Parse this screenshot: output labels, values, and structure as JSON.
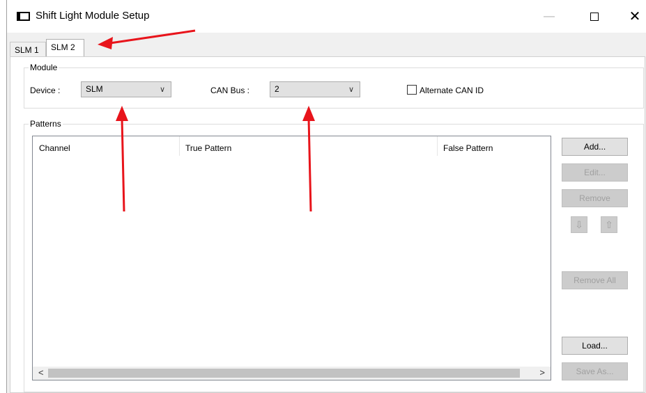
{
  "window": {
    "title": "Shift Light Module Setup",
    "minimize": "—",
    "close": "✕"
  },
  "tabs": [
    {
      "label": "SLM 1",
      "selected": false
    },
    {
      "label": "SLM 2",
      "selected": true
    }
  ],
  "module": {
    "group_label": "Module",
    "device_label": "Device :",
    "device_value": "SLM",
    "canbus_label": "CAN Bus :",
    "canbus_value": "2",
    "alternate_can_label": "Alternate CAN ID",
    "alternate_can_checked": false
  },
  "patterns": {
    "group_label": "Patterns",
    "columns": [
      "Channel",
      "True Pattern",
      "False Pattern"
    ],
    "rows": []
  },
  "buttons": {
    "add": "Add...",
    "edit": "Edit...",
    "remove": "Remove",
    "move_down": "⇩",
    "move_up": "⇧",
    "remove_all": "Remove All",
    "load": "Load...",
    "save_as": "Save As..."
  },
  "scroll": {
    "left": "<",
    "right": ">"
  },
  "annotation_color": "#e8141b"
}
